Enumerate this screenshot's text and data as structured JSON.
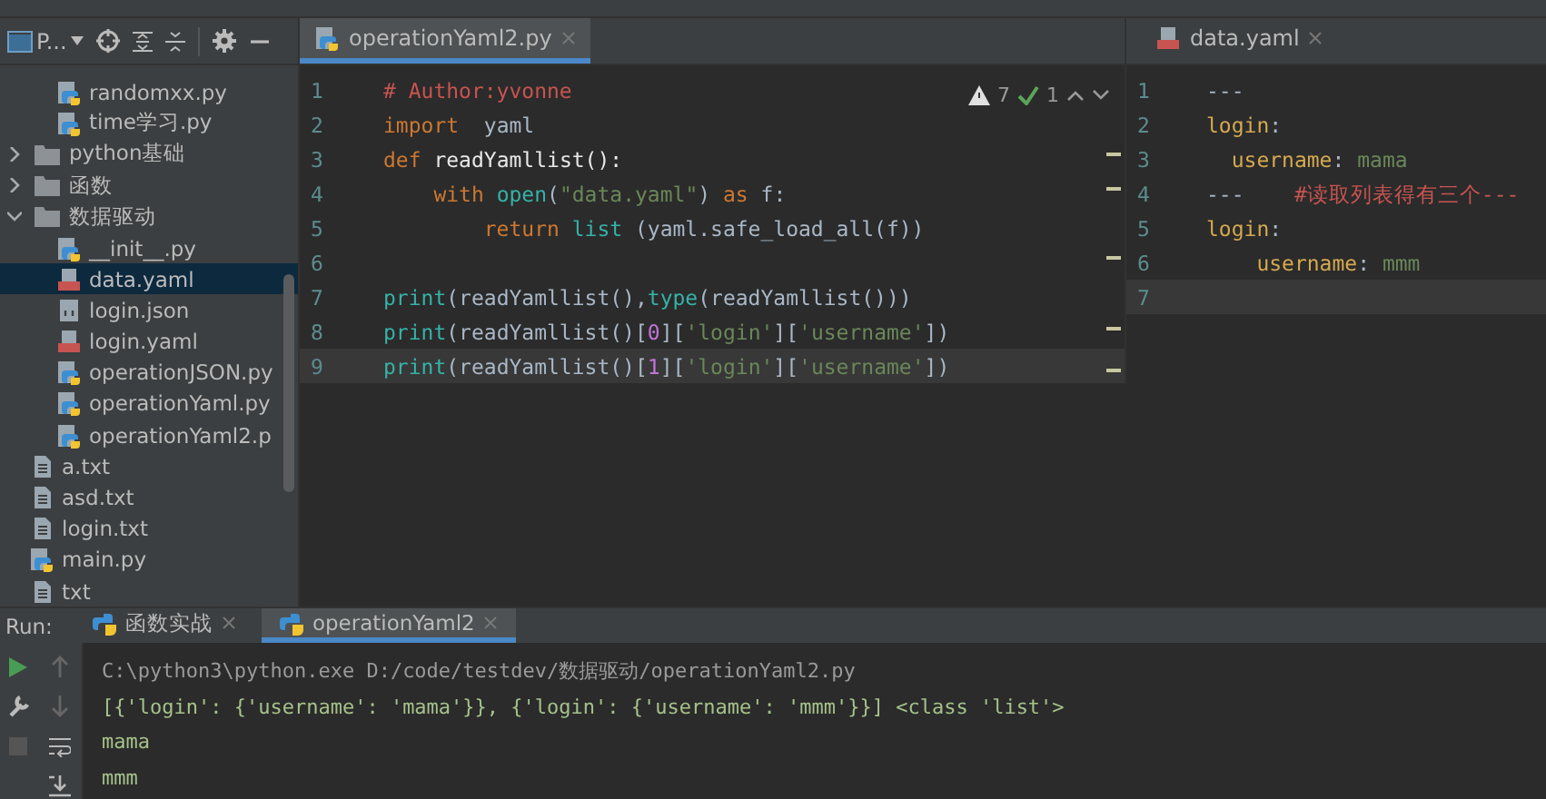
{
  "project_panel": {
    "title": "P...",
    "tree": [
      {
        "kind": "group",
        "children": [
          {
            "label": "randomxx.py",
            "kind": "python",
            "selected": false
          },
          {
            "label": "time学习.py",
            "kind": "python",
            "selected": false
          }
        ]
      },
      {
        "label": "python基础",
        "kind": "folder",
        "expanded": false,
        "selected": false
      },
      {
        "label": "函数",
        "kind": "folder",
        "expanded": false,
        "selected": false
      },
      {
        "label": "数据驱动",
        "kind": "folder",
        "expanded": true,
        "selected": false,
        "children": [
          {
            "label": "__init__.py",
            "kind": "python",
            "selected": false
          },
          {
            "label": "data.yaml",
            "kind": "yaml",
            "selected": true
          },
          {
            "label": "login.json",
            "kind": "json",
            "selected": false
          },
          {
            "label": "login.yaml",
            "kind": "yaml",
            "selected": false
          },
          {
            "label": "operationJSON.py",
            "kind": "python",
            "selected": false
          },
          {
            "label": "operationYaml.py",
            "kind": "python",
            "selected": false
          },
          {
            "label": "operationYaml2.p",
            "kind": "python",
            "selected": false
          }
        ]
      },
      {
        "label": "a.txt",
        "kind": "text",
        "selected": false
      },
      {
        "label": "asd.txt",
        "kind": "text",
        "selected": false
      },
      {
        "label": "login.txt",
        "kind": "text",
        "selected": false
      },
      {
        "label": "main.py",
        "kind": "python",
        "selected": false
      },
      {
        "label": "txt",
        "kind": "text",
        "selected": false
      }
    ]
  },
  "editor": {
    "tab": {
      "label": "operationYaml2.py",
      "kind": "python",
      "selected": true
    },
    "warnings": "7",
    "passed": "1",
    "lines": [
      {
        "number": "1",
        "current": false,
        "tokens": [
          {
            "kind": "comment",
            "text": "# Author:yvonne"
          }
        ]
      },
      {
        "number": "2",
        "current": false,
        "tokens": [
          {
            "kind": "keyword",
            "text": "import"
          },
          {
            "kind": "plain",
            "text": "  yaml"
          }
        ]
      },
      {
        "number": "3",
        "current": false,
        "tokens": [
          {
            "kind": "keyword",
            "text": "def"
          },
          {
            "kind": "func",
            "text": " readYamllist():"
          }
        ]
      },
      {
        "number": "4",
        "current": false,
        "tokens": [
          {
            "kind": "keyword",
            "text": "    with"
          },
          {
            "kind": "builtin",
            "text": " open"
          },
          {
            "kind": "plain",
            "text": "("
          },
          {
            "kind": "string",
            "text": "\"data.yaml\""
          },
          {
            "kind": "plain",
            "text": ") "
          },
          {
            "kind": "keyword",
            "text": "as"
          },
          {
            "kind": "plain",
            "text": " f:"
          }
        ]
      },
      {
        "number": "5",
        "current": false,
        "tokens": [
          {
            "kind": "keyword",
            "text": "        return"
          },
          {
            "kind": "builtin",
            "text": " list"
          },
          {
            "kind": "plain",
            "text": " (yaml.safe_load_all(f))"
          }
        ]
      },
      {
        "number": "6",
        "current": false
      },
      {
        "number": "7",
        "current": false,
        "tokens": [
          {
            "kind": "builtin",
            "text": "print"
          },
          {
            "kind": "plain",
            "text": "(readYamllist(),"
          },
          {
            "kind": "builtin",
            "text": "type"
          },
          {
            "kind": "plain",
            "text": "(readYamllist()))"
          }
        ]
      },
      {
        "number": "8",
        "current": false,
        "tokens": [
          {
            "kind": "builtin",
            "text": "print"
          },
          {
            "kind": "plain",
            "text": "(readYamllist()["
          },
          {
            "kind": "number",
            "text": "0"
          },
          {
            "kind": "plain",
            "text": "]["
          },
          {
            "kind": "string",
            "text": "'login'"
          },
          {
            "kind": "plain",
            "text": "]["
          },
          {
            "kind": "string",
            "text": "'username'"
          },
          {
            "kind": "plain",
            "text": "])"
          }
        ]
      },
      {
        "number": "9",
        "current": true,
        "tokens": [
          {
            "kind": "builtin",
            "text": "print"
          },
          {
            "kind": "plain",
            "text": "(readYamllist()["
          },
          {
            "kind": "number",
            "text": "1"
          },
          {
            "kind": "plain",
            "text": "]["
          },
          {
            "kind": "string",
            "text": "'login'"
          },
          {
            "kind": "plain",
            "text": "]["
          },
          {
            "kind": "string",
            "text": "'username'"
          },
          {
            "kind": "plain",
            "text": "])"
          }
        ]
      }
    ]
  },
  "yaml_editor": {
    "tab": {
      "label": "data.yaml",
      "kind": "yaml",
      "selected": false
    },
    "lines": [
      {
        "number": "1",
        "current": false,
        "tokens": [
          {
            "kind": "plain",
            "text": "---"
          }
        ]
      },
      {
        "number": "2",
        "current": false,
        "tokens": [
          {
            "kind": "key",
            "text": "login"
          },
          {
            "kind": "plain",
            "text": ":"
          }
        ]
      },
      {
        "number": "3",
        "current": false,
        "tokens": [
          {
            "kind": "key",
            "text": "  username"
          },
          {
            "kind": "plain",
            "text": ": "
          },
          {
            "kind": "value",
            "text": "mama"
          }
        ]
      },
      {
        "number": "4",
        "current": false,
        "tokens": [
          {
            "kind": "plain",
            "text": "---    "
          },
          {
            "kind": "comment",
            "text": "#读取列表得有三个---"
          }
        ]
      },
      {
        "number": "5",
        "current": false,
        "tokens": [
          {
            "kind": "key",
            "text": "login"
          },
          {
            "kind": "plain",
            "text": ":"
          }
        ]
      },
      {
        "number": "6",
        "current": false,
        "tokens": [
          {
            "kind": "key",
            "text": "    username"
          },
          {
            "kind": "plain",
            "text": ": "
          },
          {
            "kind": "value",
            "text": "mmm"
          }
        ]
      },
      {
        "number": "7",
        "current": true
      }
    ]
  },
  "run_panel": {
    "label": "Run:",
    "tabs": [
      {
        "label": "函数实战",
        "selected": false
      },
      {
        "label": "operationYaml2",
        "selected": true
      }
    ],
    "output": [
      {
        "kind": "command",
        "text": "C:\\python3\\python.exe D:/code/testdev/数据驱动/operationYaml2.py"
      },
      {
        "kind": "stdout",
        "text": "[{'login': {'username': 'mama'}}, {'login': {'username': 'mmm'}}] <class 'list'>"
      },
      {
        "kind": "stdout",
        "text": "mama"
      },
      {
        "kind": "stdout",
        "text": "mmm"
      }
    ]
  }
}
